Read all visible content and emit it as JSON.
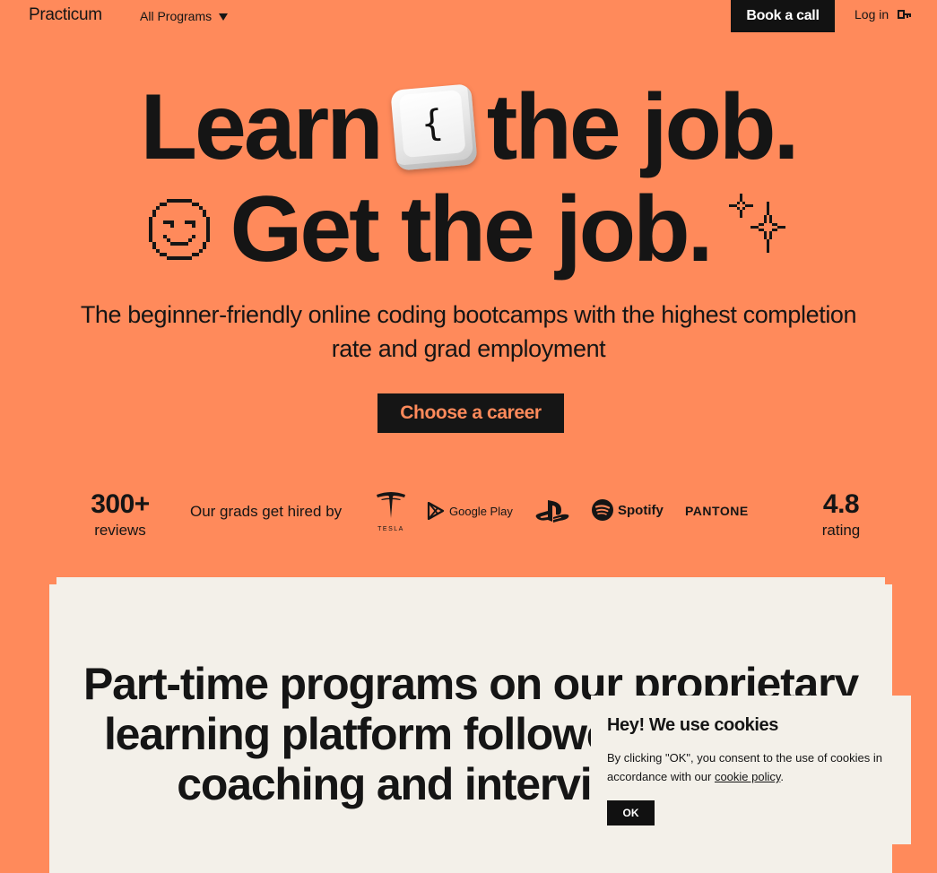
{
  "header": {
    "logo": "Practicum",
    "programs_label": "All Programs",
    "book_label": "Book a call",
    "login_label": "Log in"
  },
  "hero": {
    "word_learn": "Learn",
    "key_glyph": "{",
    "word_the_job": "the job.",
    "word_get": "Get",
    "word_the_job2": "the job.",
    "subtitle": "The beginner-friendly online coding bootcamps with the highest completion rate and grad employment",
    "cta_label": "Choose a career"
  },
  "stats": {
    "reviews_num": "300+",
    "reviews_label": "reviews",
    "hired_label": "Our grads get hired by",
    "brands": {
      "tesla": "TESLA",
      "google_play": "Google Play",
      "spotify": "Spotify",
      "pantone": "PANTONE"
    },
    "rating_num": "4.8",
    "rating_label": "rating"
  },
  "programs_section": {
    "title": "Part-time programs on our proprietary learning platform followed by career coaching and interview prep."
  },
  "cookie_banner": {
    "title": "Hey! We use cookies",
    "text_before": "By clicking \"OK\", you consent to the use of cookies in accordance with our ",
    "link_label": "cookie policy",
    "text_after": ".",
    "ok_label": "OK"
  },
  "colors": {
    "background": "#FF8A5B",
    "ink": "#151515",
    "cream": "#F3F0E9"
  }
}
